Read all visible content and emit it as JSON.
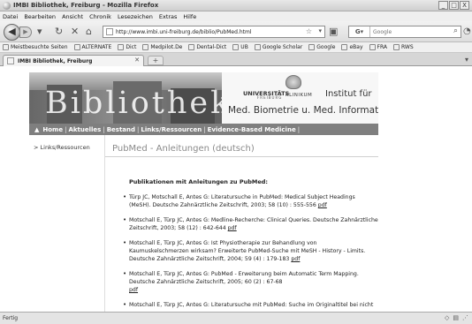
{
  "window": {
    "title": "IMBI Bibliothek, Freiburg - Mozilla Firefox",
    "controls": [
      "_",
      "□",
      "X"
    ]
  },
  "menu": [
    "Datei",
    "Bearbeiten",
    "Ansicht",
    "Chronik",
    "Lesezeichen",
    "Extras",
    "Hilfe"
  ],
  "nav": {
    "url": "http://www.imbi.uni-freiburg.de/biblio/PubMed.html",
    "search_engine": "Google",
    "search_placeholder": "Google"
  },
  "bookmarks": [
    "Meistbesuchte Seiten",
    "ALTERNATE",
    "Dict",
    "Medpilot.De",
    "Dental-Dict",
    "UB",
    "Google Scholar",
    "Google",
    "eBay",
    "FRA",
    "RWS"
  ],
  "tab": {
    "title": "IMBI Bibliothek, Freiburg"
  },
  "banner": {
    "bibliothek_text": "Bibliothek",
    "logo_line1": "UNIVERSITÄTS",
    "logo_line2": "KLINIKUM",
    "logo_line3": "FREIBURG",
    "institut_line1": "Institut für",
    "institut_line2": "Med. Biometrie u. Med. Informatik"
  },
  "site_nav": [
    "Home",
    "Aktuelles",
    "Bestand",
    "Links/Ressourcen",
    "Evidence-Based Medicine"
  ],
  "sidebar": {
    "link": "> Links/Ressourcen"
  },
  "page": {
    "heading": "PubMed - Anleitungen (deutsch)",
    "section_title": "Publikationen mit Anleitungen zu PubMed:",
    "pdf_label": "pdf",
    "items": [
      "Türp JC, Motschall E, Antes G: Literatursuche in PubMed: Medical Subject Headings (MeSH). Deutsche Zahnärztliche Zeitschrift, 2003; 58 (10) : 555-556",
      "Motschall E, Türp JC, Antes G: Medline-Recherche: Clinical Queries. Deutsche Zahnärztliche Zeitschrift, 2003; 58 (12) : 642-644",
      "Motschall E, Türp JC, Antes G: Ist Physiotherapie zur Behandlung von Kaumuskelschmerzen wirksam? Erweiterte PubMed-Suche mit MeSH - History - Limits. Deutsche Zahnärztliche Zeitschrift, 2004; 59 (4) : 179-183",
      "Motschall E, Türp JC, Antes G: PubMed - Erweiterung beim Automatic Term Mapping. Deutsche Zahnärztliche Zeitschrift, 2005; 60 (2) : 67-68",
      "Motschall E, Türp JC, Antes G: Literatursuche mit PubMed: Suche im Originaltitel bei nicht ..."
    ]
  },
  "status": {
    "text": "Fertig"
  }
}
